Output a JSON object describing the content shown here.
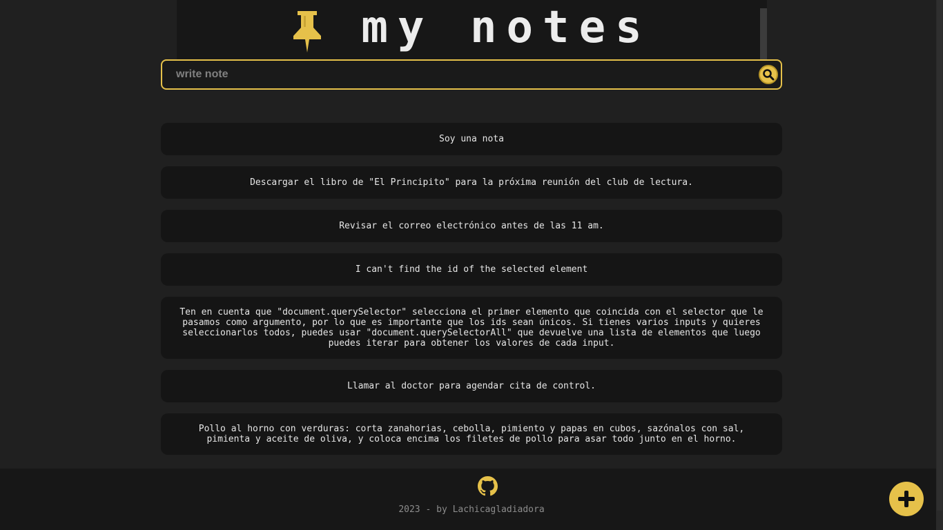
{
  "header": {
    "title": "my notes",
    "icon": "pushpin-icon"
  },
  "search": {
    "placeholder": "write note",
    "value": ""
  },
  "notes": [
    "Soy una nota",
    "Descargar el libro de \"El Principito\" para la próxima reunión del club de lectura.",
    "Revisar el correo electrónico antes de las 11 am.",
    "I can't find the id of the selected element",
    "Ten en cuenta que \"document.querySelector\" selecciona el primer elemento que coincida con el selector que le pasamos como argumento, por lo que es importante que los ids sean únicos. Si tienes varios inputs y quieres seleccionarlos todos, puedes usar \"document.querySelectorAll\" que devuelve una lista de elementos que luego puedes iterar para obtener los valores de cada input.",
    "Llamar al doctor para agendar cita de control.",
    "Pollo al horno con verduras: corta zanahorias, cebolla, pimiento y papas en cubos, sazónalos con sal, pimienta y aceite de oliva, y coloca encima los filetes de pollo para asar todo junto en el horno."
  ],
  "footer": {
    "text": "2023 - by Lachicagladiadora",
    "icon": "github-icon"
  },
  "colors": {
    "accent": "#e6c14a",
    "background": "#202020",
    "card": "#151515"
  }
}
